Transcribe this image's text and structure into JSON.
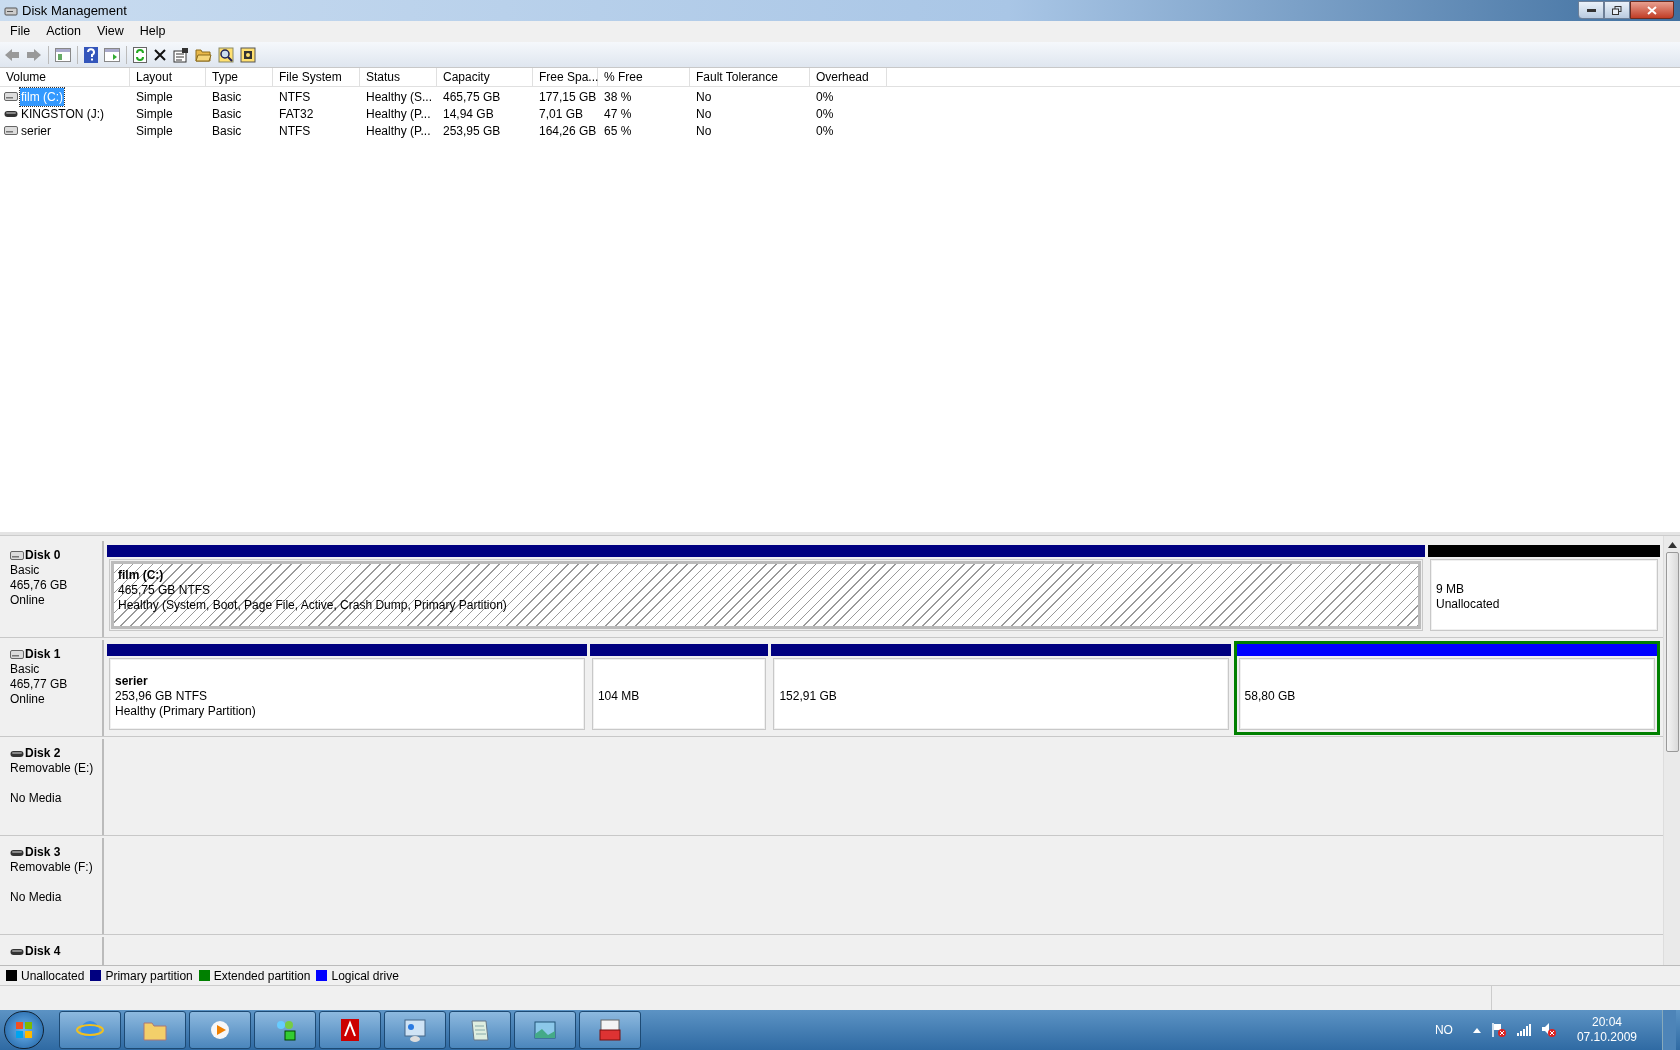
{
  "window": {
    "title": "Disk Management"
  },
  "menu": [
    "File",
    "Action",
    "View",
    "Help"
  ],
  "table": {
    "columns": [
      "Volume",
      "Layout",
      "Type",
      "File System",
      "Status",
      "Capacity",
      "Free Spa...",
      "% Free",
      "Fault Tolerance",
      "Overhead"
    ],
    "rows": [
      {
        "kind": "fixed",
        "selected": true,
        "cells": [
          "film (C:)",
          "Simple",
          "Basic",
          "NTFS",
          "Healthy (S...",
          "465,75 GB",
          "177,15 GB",
          "38 %",
          "No",
          "0%"
        ]
      },
      {
        "kind": "removable",
        "selected": false,
        "cells": [
          "KINGSTON (J:)",
          "Simple",
          "Basic",
          "FAT32",
          "Healthy (P...",
          "14,94 GB",
          "7,01 GB",
          "47 %",
          "No",
          "0%"
        ]
      },
      {
        "kind": "fixed",
        "selected": false,
        "cells": [
          "serier",
          "Simple",
          "Basic",
          "NTFS",
          "Healthy (P...",
          "253,95 GB",
          "164,26 GB",
          "65 %",
          "No",
          "0%"
        ]
      }
    ]
  },
  "disks": [
    {
      "kind": "fixed",
      "name": "Disk 0",
      "lines": [
        "Basic",
        "465,76 GB",
        "Online"
      ],
      "partitions": [
        {
          "kind": "primary",
          "selected": true,
          "title": "film  (C:)",
          "lines": [
            "465,75 GB NTFS",
            "Healthy (System, Boot, Page File, Active, Crash Dump, Primary Partition)"
          ]
        },
        {
          "kind": "unallocated",
          "selected": false,
          "lines": [
            "9 MB",
            "Unallocated"
          ]
        }
      ]
    },
    {
      "kind": "fixed",
      "name": "Disk 1",
      "lines": [
        "Basic",
        "465,77 GB",
        "Online"
      ],
      "partitions": [
        {
          "kind": "primary",
          "selected": false,
          "title": "serier",
          "lines": [
            "253,96 GB NTFS",
            "Healthy (Primary Partition)"
          ]
        },
        {
          "kind": "primary",
          "selected": false,
          "lines": [
            "104 MB"
          ]
        },
        {
          "kind": "primary",
          "selected": false,
          "lines": [
            "152,91 GB"
          ]
        },
        {
          "kind": "logical",
          "selected": false,
          "lines": [
            "58,80 GB"
          ]
        }
      ]
    },
    {
      "kind": "removable",
      "name": "Disk 2",
      "lines": [
        "Removable (E:)",
        "No Media"
      ]
    },
    {
      "kind": "removable",
      "name": "Disk 3",
      "lines": [
        "Removable (F:)",
        "No Media"
      ]
    },
    {
      "kind": "removable",
      "name": "Disk 4"
    }
  ],
  "legend": [
    {
      "label": "Unallocated",
      "color": "#000000"
    },
    {
      "label": "Primary partition",
      "color": "#000080"
    },
    {
      "label": "Extended partition",
      "color": "#008000"
    },
    {
      "label": "Logical drive",
      "color": "#0000ff"
    }
  ],
  "taskbar": {
    "language": "NO",
    "time": "20:04",
    "date": "07.10.2009"
  }
}
